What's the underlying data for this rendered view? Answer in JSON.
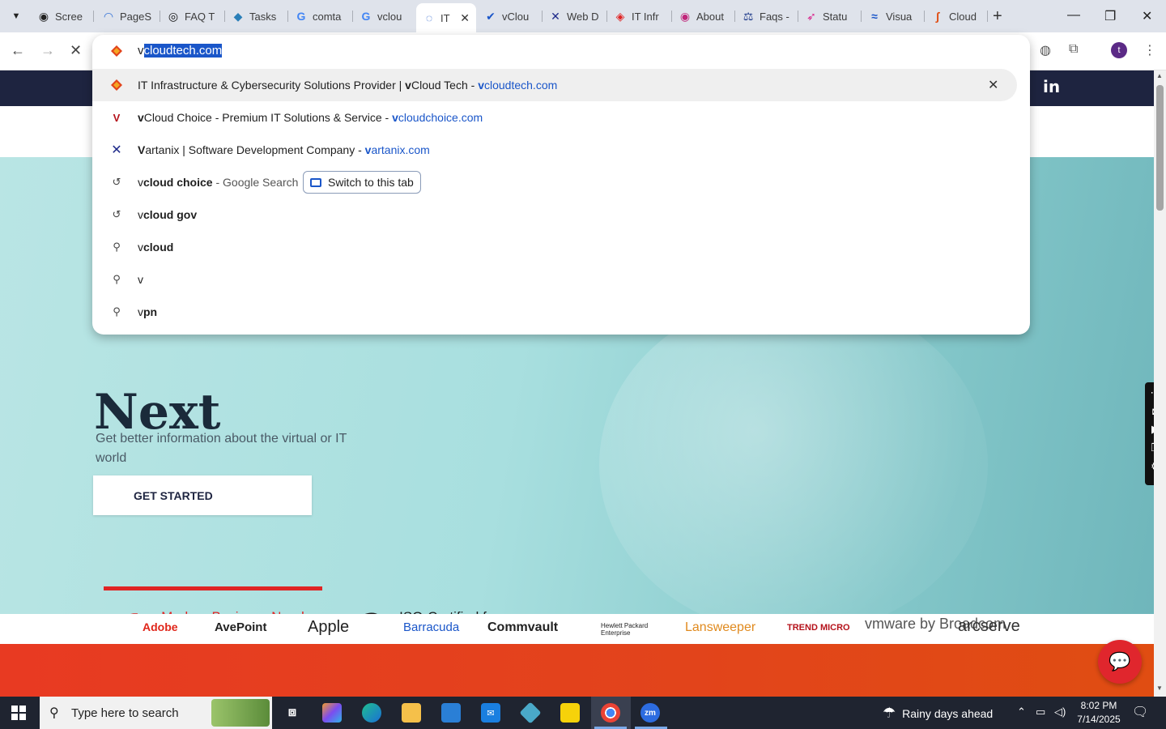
{
  "tabs": [
    {
      "label": "Scree",
      "color": "#222222",
      "glyph": "◉"
    },
    {
      "label": "PageS",
      "color": "#2f6fd6",
      "glyph": "◠"
    },
    {
      "label": "FAQ T",
      "color": "#111111",
      "glyph": "◎"
    },
    {
      "label": "Tasks",
      "color": "#2a7fb8",
      "glyph": "◆"
    },
    {
      "label": "comta",
      "color": "#4285f4",
      "glyph": "G"
    },
    {
      "label": "vclou",
      "color": "#4285f4",
      "glyph": "G"
    },
    {
      "label": "IT",
      "color": "#1a56c9",
      "glyph": "◌"
    },
    {
      "label": "vClou",
      "color": "#1a56c9",
      "glyph": "✔"
    },
    {
      "label": "Web D",
      "color": "#1e2a8a",
      "glyph": "✕"
    },
    {
      "label": "IT Infr",
      "color": "#e02424",
      "glyph": "◈"
    },
    {
      "label": "About",
      "color": "#c0267a",
      "glyph": "◉"
    },
    {
      "label": "Faqs -",
      "color": "#1e3a8a",
      "glyph": "⚖"
    },
    {
      "label": "Statu",
      "color": "#d9208a",
      "glyph": "➶"
    },
    {
      "label": "Visua",
      "color": "#1a56c9",
      "glyph": "≈"
    },
    {
      "label": "Cloud",
      "color": "#e04d12",
      "glyph": "∫"
    }
  ],
  "omnibox": {
    "typed": "v",
    "autocomplete": "cloudtech.com",
    "suggestions": [
      {
        "pre": "IT Infrastructure & Cybersecurity Solutions Provider | ",
        "b1": "v",
        "mid": "Cloud Tech - ",
        "url_b": "v",
        "url": "cloudtech.com"
      },
      {
        "pre": "",
        "b1": "v",
        "mid": "Cloud Choice - Premium IT Solutions & Service - ",
        "url_b": "v",
        "url": "cloudchoice.com"
      },
      {
        "pre": "",
        "b1": "V",
        "mid": "artanix | Software Development Company - ",
        "url_b": "v",
        "url": "artanix.com"
      },
      {
        "q1": "v",
        "q2": "cloud choice",
        "suffix": " - Google Search",
        "chip": "Switch to this tab"
      },
      {
        "q1": "v",
        "q2": "cloud gov"
      },
      {
        "q1": "v",
        "q2": "cloud"
      },
      {
        "q1": "v",
        "q2": ""
      },
      {
        "q1": "v",
        "q2": "pn"
      }
    ]
  },
  "profile_initial": "t",
  "hero": {
    "partial_title": "Next",
    "subtitle": "Get better information about the virtual or IT world",
    "cta": "GET STARTED"
  },
  "features": [
    {
      "num": "1",
      "text": "Modern Business Needs Future-Ready Architecture"
    },
    {
      "num": "2",
      "text": "ISO-Certified for Exceptional Quality and Reliability"
    }
  ],
  "site": {
    "social": "in"
  },
  "partners": [
    "Adobe",
    "AvePoint",
    "Apple",
    "Barracuda",
    "Commvault",
    "Hewlett Packard Enterprise",
    "Lansweeper",
    "TREND MICRO",
    "vmware by Broadcom",
    "arcserve"
  ],
  "taskbar": {
    "search_placeholder": "Type here to search",
    "weather": "Rainy days ahead",
    "time": "8:02 PM",
    "date": "7/14/2025"
  },
  "colors": {
    "brand_red": "#e02424",
    "navy": "#1e2440",
    "link_blue": "#1a56c9"
  }
}
